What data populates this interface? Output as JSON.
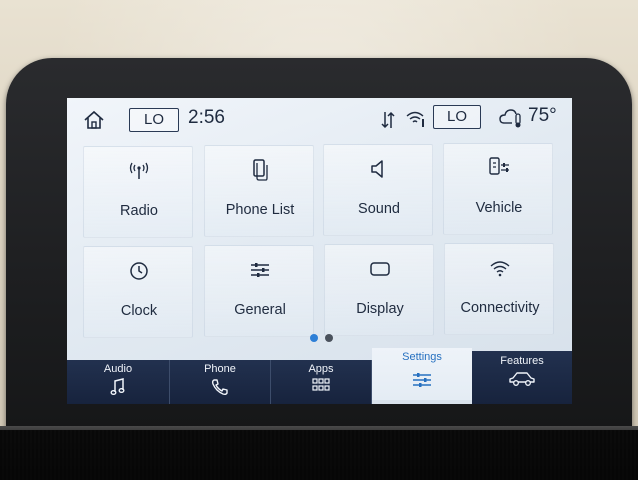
{
  "status_bar": {
    "left_fan_level": "LO",
    "time": "2:56",
    "right_fan_level": "LO",
    "outside_temp": "75°"
  },
  "tiles": [
    {
      "label": "Radio",
      "icon": "radio-antenna-icon"
    },
    {
      "label": "Phone List",
      "icon": "phone-list-icon"
    },
    {
      "label": "Sound",
      "icon": "speaker-icon"
    },
    {
      "label": "Vehicle",
      "icon": "vehicle-settings-icon"
    },
    {
      "label": "Clock",
      "icon": "clock-icon"
    },
    {
      "label": "General",
      "icon": "sliders-icon"
    },
    {
      "label": "Display",
      "icon": "display-icon"
    },
    {
      "label": "Connectivity",
      "icon": "wifi-icon"
    }
  ],
  "pager": {
    "pages": 2,
    "current": 1
  },
  "nav": [
    {
      "label": "Audio",
      "icon": "music-note-icon"
    },
    {
      "label": "Phone",
      "icon": "phone-handset-icon"
    },
    {
      "label": "Apps",
      "icon": "apps-grid-icon"
    },
    {
      "label": "Settings",
      "icon": "settings-sliders-icon",
      "active": true
    },
    {
      "label": "Features",
      "icon": "car-icon"
    }
  ],
  "colors": {
    "accent": "#2d7fd6",
    "nav_background": "#1b2842",
    "text": "#1f2b40"
  }
}
